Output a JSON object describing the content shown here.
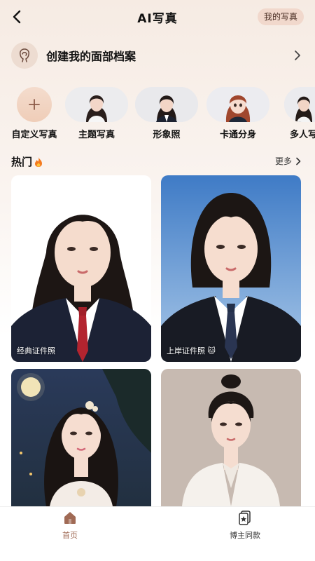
{
  "header": {
    "title": "AI写真",
    "my_photos": "我的写真"
  },
  "profile": {
    "label": "创建我的面部档案"
  },
  "categories": [
    {
      "label": "自定义写真"
    },
    {
      "label": "主题写真"
    },
    {
      "label": "形象照"
    },
    {
      "label": "卡通分身"
    },
    {
      "label": "多人写"
    }
  ],
  "hot": {
    "title": "热门",
    "more": "更多"
  },
  "cards": [
    {
      "caption": "经典证件照"
    },
    {
      "caption": "上岸证件照"
    },
    {
      "caption": ""
    },
    {
      "caption": ""
    }
  ],
  "tabs": [
    {
      "label": "首页",
      "active": true
    },
    {
      "label": "博主同款",
      "active": false
    }
  ],
  "colors": {
    "accent": "#8c5a47",
    "chip_bg": "#f1d8cc",
    "active_tab": "#a06a55"
  }
}
